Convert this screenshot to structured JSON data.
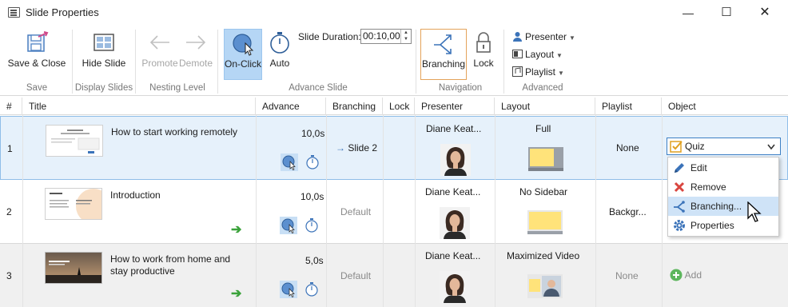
{
  "window": {
    "title": "Slide Properties",
    "minimize": "—",
    "maximize": "☐",
    "close": "✕"
  },
  "ribbon": {
    "save_close": "Save & Close",
    "hide_slide": "Hide Slide",
    "promote": "Promote",
    "demote": "Demote",
    "on_click": "On-Click",
    "auto": "Auto",
    "slide_duration_label": "Slide Duration:",
    "slide_duration_value": "00:10,00",
    "branching": "Branching",
    "lock": "Lock",
    "presenter": "Presenter",
    "layout": "Layout",
    "playlist": "Playlist",
    "groups": {
      "save": "Save",
      "display_slides": "Display Slides",
      "nesting_level": "Nesting Level",
      "advance_slide": "Advance Slide",
      "navigation": "Navigation",
      "advanced": "Advanced"
    }
  },
  "table": {
    "headers": [
      "#",
      "Title",
      "Advance",
      "Branching",
      "Lock",
      "Presenter",
      "Layout",
      "Playlist",
      "Object"
    ],
    "rows": [
      {
        "num": "1",
        "title_lines": [
          "How to start working remotely"
        ],
        "advance": "10,0s",
        "branching": "Slide 2",
        "presenter": "Diane Keat...",
        "layout": "Full",
        "playlist": "None",
        "object": "Quiz"
      },
      {
        "num": "2",
        "title_lines": [
          "Introduction"
        ],
        "advance": "10,0s",
        "branching": "Default",
        "presenter": "Diane Keat...",
        "layout": "No Sidebar",
        "playlist": "Backgr...",
        "object": ""
      },
      {
        "num": "3",
        "title_lines": [
          "How to work from home and",
          "stay productive"
        ],
        "advance": "5,0s",
        "branching": "Default",
        "presenter": "Diane Keat...",
        "layout": "Maximized Video",
        "playlist": "None",
        "object": "Add"
      }
    ]
  },
  "context_menu": {
    "items": [
      "Edit",
      "Remove",
      "Branching...",
      "Properties"
    ],
    "highlighted_index": 2
  },
  "icons": {
    "app": "slide-properties-icon",
    "branching_arrow": "→"
  },
  "colors": {
    "accent": "#3c7fc4",
    "selection": "#e6f1fb",
    "active_button": "#b5d6f5",
    "branching_border": "#e4a35a",
    "green": "#3aa23a",
    "layout_yellow": "#ffe37a"
  }
}
